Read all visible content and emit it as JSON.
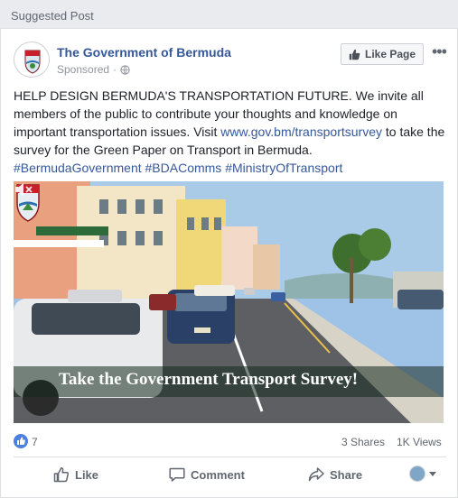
{
  "feed": {
    "label": "Suggested Post"
  },
  "post": {
    "page_name": "The Government of Bermuda",
    "sponsored": "Sponsored",
    "separator": "·",
    "like_page_label": "Like Page",
    "more_label": "•••",
    "text_before_link": "HELP DESIGN BERMUDA'S TRANSPORTATION FUTURE. We invite all members of the public to contribute your thoughts and knowledge on important transportation issues. Visit ",
    "link": "www.gov.bm/transportsurvey",
    "text_after_link": " to take the survey for the Green Paper on Transport in Bermuda.",
    "hashtags": "#BermudaGovernment #BDAComms #MinistryOfTransport",
    "video": {
      "banner_text": "Take the Government Transport Survey!",
      "mute_icon": "volume-mute-icon"
    }
  },
  "stats": {
    "like_count": "7",
    "shares": "3 Shares",
    "views": "1K Views"
  },
  "actions": {
    "like": "Like",
    "comment": "Comment",
    "share": "Share"
  },
  "colors": {
    "link": "#365899",
    "like_blue": "#4c7fe0",
    "muted_text": "#90949c"
  }
}
